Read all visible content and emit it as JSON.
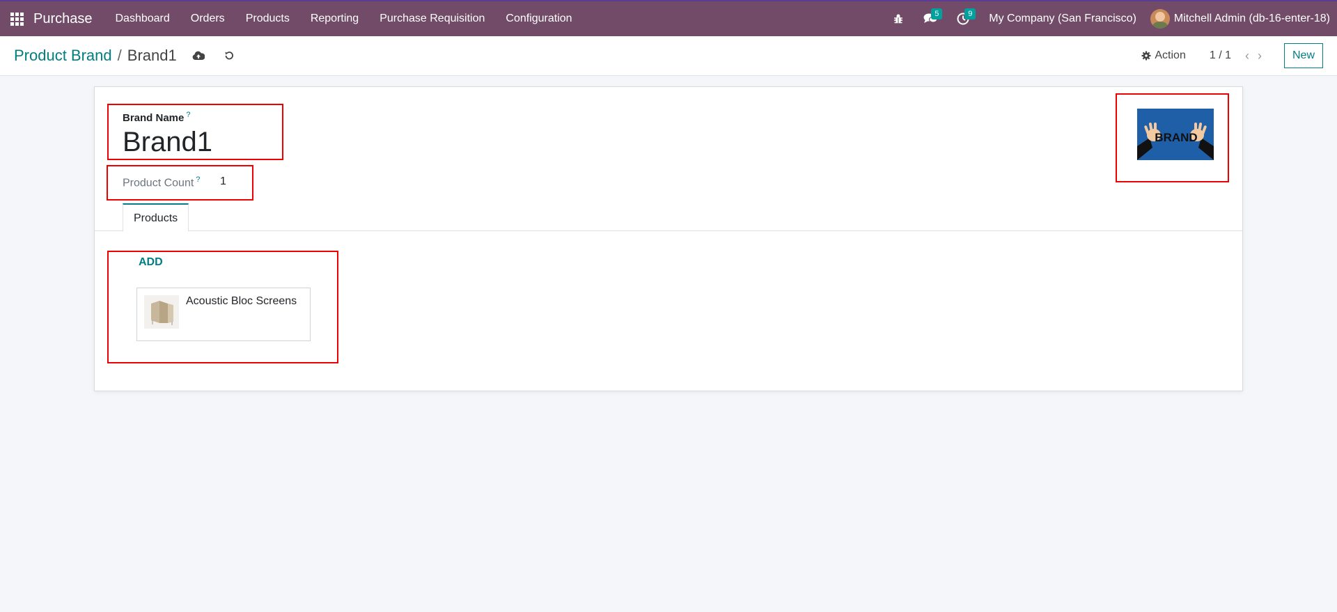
{
  "navbar": {
    "app_name": "Purchase",
    "menu": [
      "Dashboard",
      "Orders",
      "Products",
      "Reporting",
      "Purchase Requisition",
      "Configuration"
    ],
    "messages_count": "5",
    "activities_count": "9",
    "company": "My Company (San Francisco)",
    "user": "Mitchell Admin (db-16-enter-18)"
  },
  "control_panel": {
    "breadcrumb_parent": "Product Brand",
    "breadcrumb_separator": "/",
    "breadcrumb_current": "Brand1",
    "action_label": "Action",
    "pager": "1 / 1",
    "new_label": "New"
  },
  "form": {
    "brand_name_label": "Brand Name",
    "help_mark": "?",
    "brand_name_value": "Brand1",
    "product_count_label": "Product Count",
    "product_count_value": "1",
    "tab_label": "Products",
    "add_label": "ADD",
    "products": [
      {
        "name": "Acoustic Bloc Screens"
      }
    ],
    "logo_text": "BRAND"
  },
  "colors": {
    "navbar": "#714b67",
    "accent": "#017e84",
    "highlight": "#e00000"
  }
}
